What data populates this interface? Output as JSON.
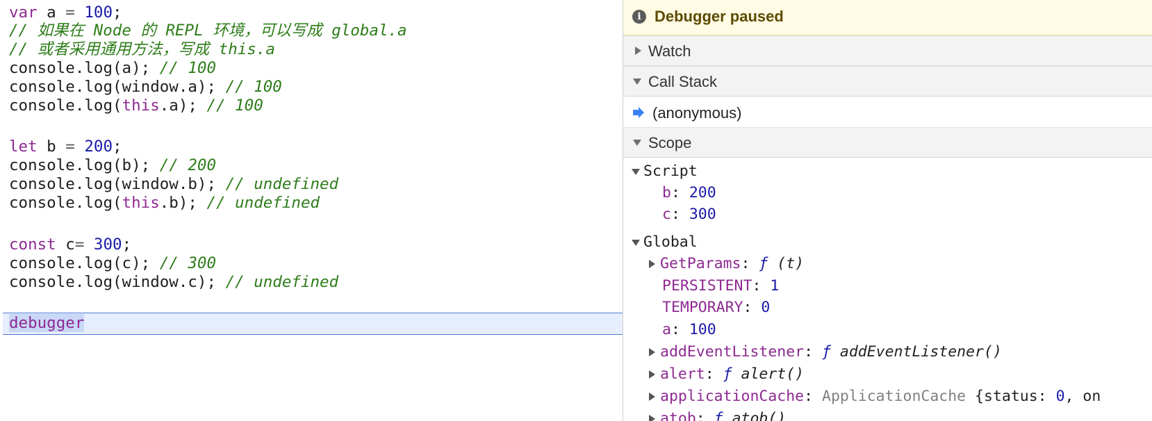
{
  "editor": {
    "lines": [
      {
        "kw": "var",
        "id": " a ",
        "op": "=",
        "num": " 100",
        "rest": ";"
      },
      {
        "comment": "// 如果在 Node 的 REPL 环境，可以写成 global.a"
      },
      {
        "comment": "// 或者采用通用方法，写成 this.a"
      },
      {
        "code": "console.log(a); ",
        "comment": "// 100"
      },
      {
        "code": "console.log(window.a); ",
        "comment": "// 100"
      },
      {
        "pre": "console.log(",
        "kw": "this",
        "code": ".a); ",
        "comment": "// 100"
      },
      {
        "kw": "let",
        "id": " b ",
        "op": "=",
        "num": " 200",
        "rest": ";"
      },
      {
        "code": "console.log(b); ",
        "comment": "// 200"
      },
      {
        "code": "console.log(window.b); ",
        "comment": "// undefined"
      },
      {
        "pre": "console.log(",
        "kw": "this",
        "code": ".b); ",
        "comment": "// undefined"
      },
      {
        "kw": "const",
        "id": " c",
        "op": "=",
        "num": " 300",
        "rest": ";"
      },
      {
        "code": "console.log(c); ",
        "comment": "// 300"
      },
      {
        "code": "console.log(window.c); ",
        "comment": "// undefined"
      }
    ],
    "current_line": {
      "part1": "de",
      "part2": "bugger"
    }
  },
  "debugger": {
    "paused_text": "Debugger paused",
    "paused_icon": "info-icon",
    "panes": {
      "watch": "Watch",
      "call_stack": "Call Stack",
      "scope": "Scope"
    },
    "call_frame": "(anonymous)",
    "scope": {
      "script": {
        "label": "Script",
        "vars": [
          {
            "name": "b",
            "value": "200"
          },
          {
            "name": "c",
            "value": "300"
          }
        ]
      },
      "global": {
        "label": "Global",
        "items": [
          {
            "name": "GetParams",
            "f": "ƒ",
            "value": " (t)",
            "expandable": true
          },
          {
            "name": "PERSISTENT",
            "value": "1"
          },
          {
            "name": "TEMPORARY",
            "value": "0"
          },
          {
            "name": "a",
            "value": "100"
          },
          {
            "name": "addEventListener",
            "f": "ƒ",
            "value": " addEventListener()",
            "expandable": true
          },
          {
            "name": "alert",
            "f": "ƒ",
            "value": " alert()",
            "expandable": true
          },
          {
            "name": "applicationCache",
            "type": "ApplicationCache",
            "value_pre": " {status: ",
            "value_num": "0",
            "value_post": ", on",
            "expandable": true
          },
          {
            "name": "atob",
            "f": "ƒ",
            "value": " atob()",
            "expandable": true
          }
        ]
      }
    }
  }
}
